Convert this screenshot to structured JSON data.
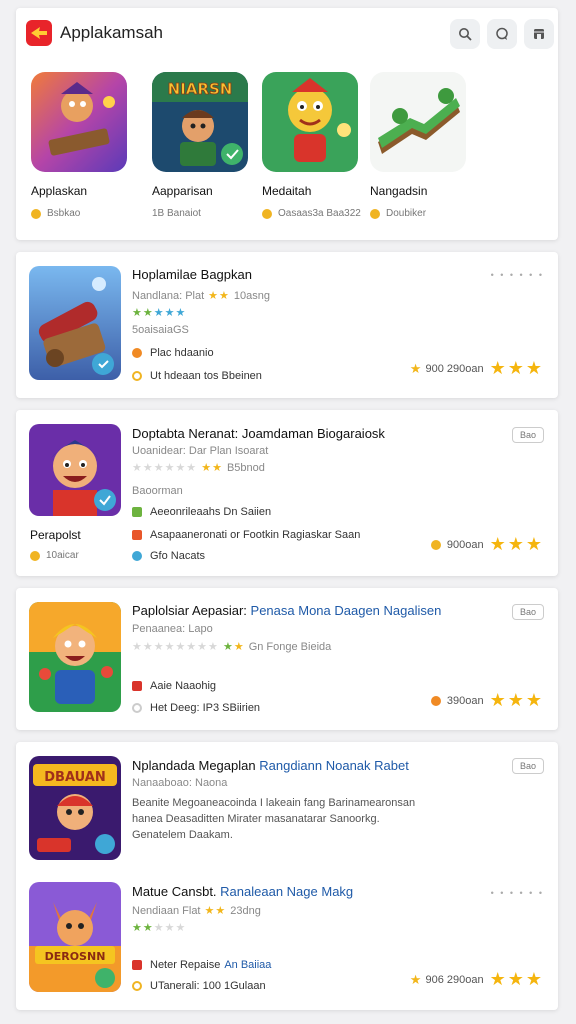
{
  "app": {
    "title": "Applakamsah"
  },
  "header": {
    "icons": [
      "search-icon",
      "chat-icon",
      "store-icon"
    ]
  },
  "featured": [
    {
      "name": "Applaskan",
      "meta": "Bsbkao"
    },
    {
      "name": "Aapparisan",
      "meta": "1B Banaiot"
    },
    {
      "name": "Medaitah",
      "meta": "Oasaas3a Baa322"
    },
    {
      "name": "Nangadsin",
      "meta": "Doubiker"
    }
  ],
  "items": [
    {
      "title": "Hoplamilae Bagpkan",
      "title_accent": "",
      "subtitle": "Nandlana: Plat",
      "subtitle_rating": "10asng",
      "tag": "5oaisaiaGS",
      "line1": "Plac hdaanio",
      "line2": "Ut hdeaan tos Bbeinen",
      "price": "900 290oan",
      "dots": "• • • • • •"
    },
    {
      "title": "Doptabta Neranat: Joamdaman Biogaraiosk",
      "title_accent": "",
      "subtitle": "Uoanidear: Dar Plan Isoarat",
      "subtitle_rating": "B5bnod",
      "tag": "Baoorman",
      "caption": "Perapolst",
      "caption_meta": "10aicar",
      "line1": "Aeeonrileaahs Dn Saiien",
      "line2": "Asapaaneronati or Footkin Ragiaskar Saan",
      "line3": "Gfo Nacats",
      "price": "900oan",
      "pill": "Bao"
    },
    {
      "title": "Paplolsiar Aepasiar:",
      "title_accent": "Penasa Mona Daagen Nagalisen",
      "subtitle": "Penaanea: Lapo",
      "subtitle_rating": "Gn Fonge Bieida",
      "line1": "Aaie Naaohig",
      "line2": "Het Deeg: IP3 SBiirien",
      "price": "390oan",
      "pill": "Bao"
    },
    {
      "title": "Nplandada Megaplan",
      "title_accent": "Rangdiann Noanak Rabet",
      "subtitle": "Nanaaboao: Naona",
      "desc": "Beanite Megoaneacoinda I lakeain fang Barinamearonsan hanea Deasaditten Mirater masanatarar Sanoorkg. Genatelem Daakam.",
      "pill": "Bao"
    },
    {
      "title": "Matue Cansbt.",
      "title_accent": "Ranaleaan Nage Makg",
      "subtitle": "Nendiaan Flat",
      "subtitle_rating": "23dng",
      "line1": "Neter Repaise",
      "line1_accent": "An Baiiaa",
      "line2": "UTanerali: 100 1Gulaan",
      "price": "906 290oan",
      "dots": "• • • • • •"
    }
  ],
  "colors": {
    "accent": "#1f5aa8",
    "star": "#f2b61b",
    "brand": "#e8242a"
  }
}
